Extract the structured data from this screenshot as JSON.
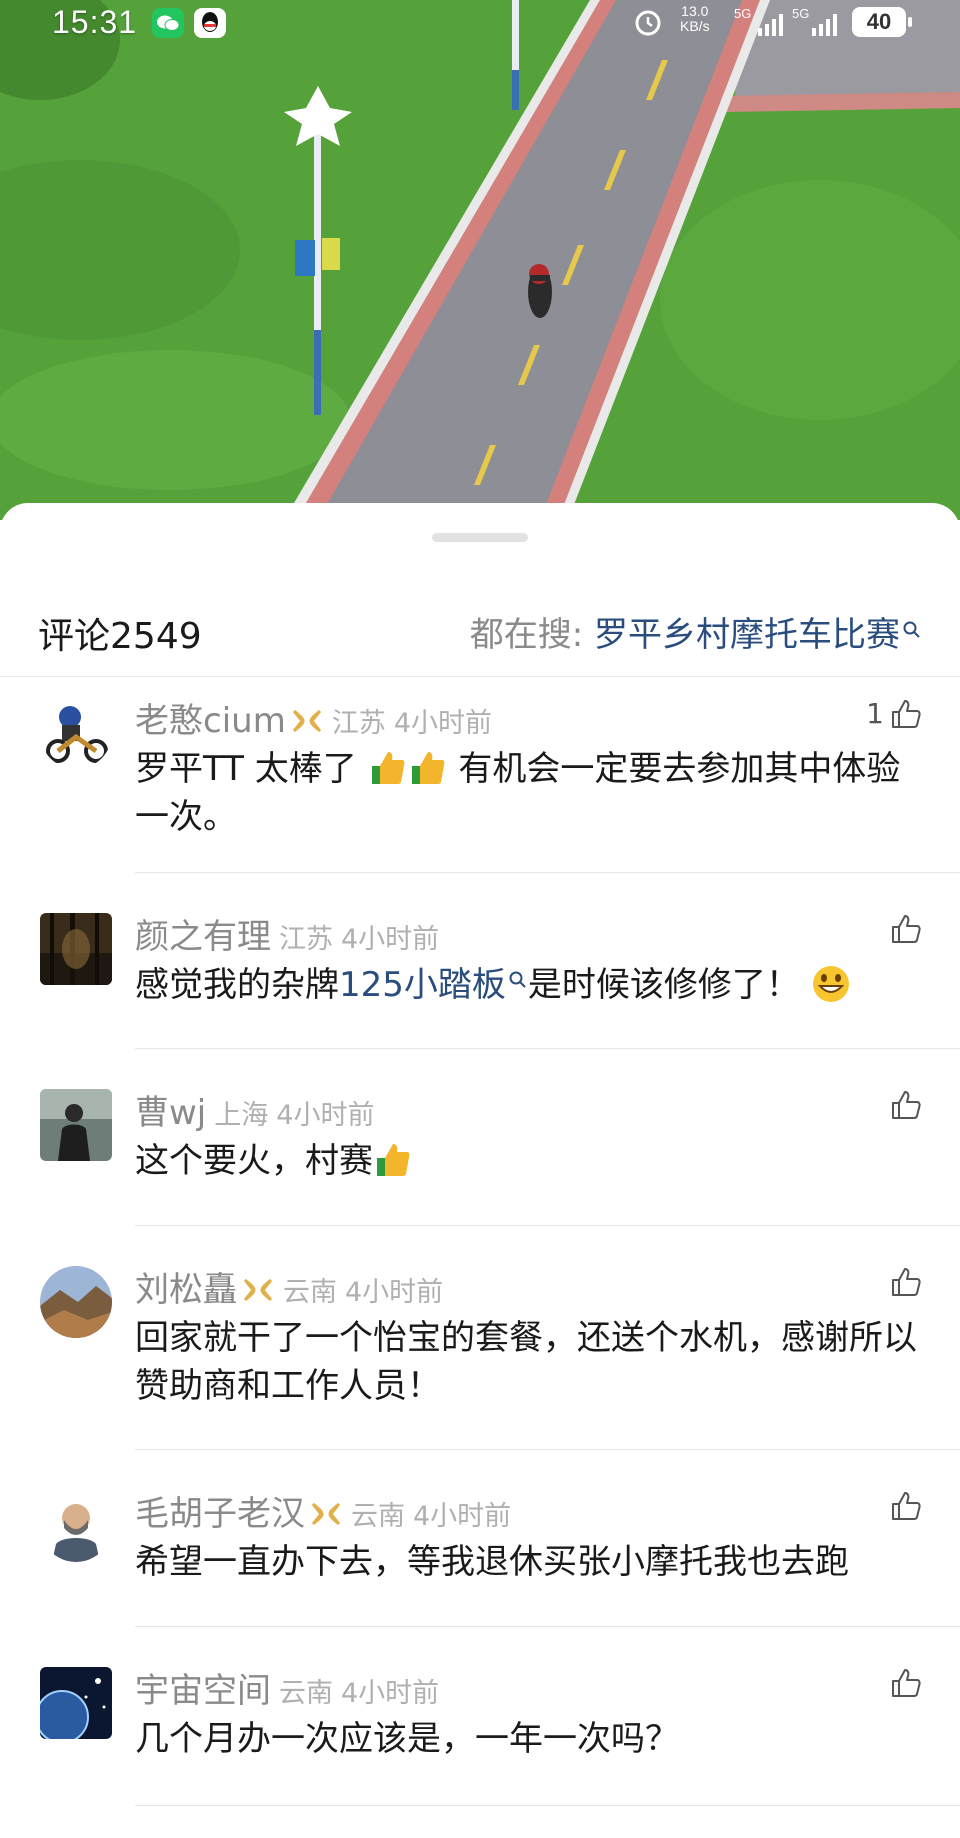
{
  "status_bar": {
    "time": "15:31",
    "speed": "13.0",
    "speed_unit": "KB/s",
    "net1": "5G",
    "net2": "5G",
    "battery": "40"
  },
  "sheet": {
    "title": "评论",
    "count": "2549",
    "hot_search_prefix": "都在搜: ",
    "hot_search_term": "罗平乡村摩托车比赛"
  },
  "comments": [
    {
      "author": "老憨cium",
      "verified": true,
      "region": "江苏",
      "time": "4小时前",
      "likes": "1",
      "text_a": "罗平TT 太棒了 ",
      "text_b": " 有机会一定要去参加其中体验一次。"
    },
    {
      "author": "颜之有理",
      "verified": false,
      "region": "江苏",
      "time": "4小时前",
      "likes": "",
      "text_a": "感觉我的杂牌",
      "link": "125小踏板",
      "text_b": "是时候该修修了！ "
    },
    {
      "author": "曹wj",
      "verified": false,
      "region": "上海",
      "time": "4小时前",
      "likes": "",
      "text_a": "这个要火，村赛"
    },
    {
      "author": "刘松矗",
      "verified": true,
      "region": "云南",
      "time": "4小时前",
      "likes": "",
      "text_a": "回家就干了一个怡宝的套餐，还送个水机，感谢所以赞助商和工作人员！"
    },
    {
      "author": "毛胡子老汉",
      "verified": true,
      "region": "云南",
      "time": "4小时前",
      "likes": "",
      "text_a": "希望一直办下去，等我退休买张小摩托我也去跑"
    },
    {
      "author": "宇宙空间",
      "verified": false,
      "region": "云南",
      "time": "4小时前",
      "likes": "",
      "text_a": "几个月办一次应该是，一年一次吗？"
    }
  ],
  "colors": {
    "link": "#2a4d7e",
    "meta_gray": "#8a8a8a",
    "badge_gold": "#e2b04a"
  },
  "icons": [
    "wechat-icon",
    "qq-icon",
    "alarm-icon",
    "signal-icon",
    "battery-icon",
    "search-icon",
    "like-icon",
    "verified-badge-icon",
    "thumbs-up-emoji",
    "grin-emoji"
  ]
}
